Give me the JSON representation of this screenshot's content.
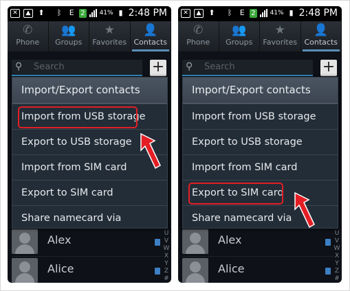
{
  "status_bar": {
    "time": "2:48 PM",
    "battery": "41%",
    "sim_badge": "2",
    "network": "E"
  },
  "tabs": [
    {
      "label": "Phone",
      "icon": "phone-icon"
    },
    {
      "label": "Groups",
      "icon": "groups-icon"
    },
    {
      "label": "Favorites",
      "icon": "star-icon"
    },
    {
      "label": "Contacts",
      "icon": "person-icon",
      "active": true
    }
  ],
  "search": {
    "placeholder": "Search"
  },
  "dialog": {
    "title": "Import/Export contacts",
    "items": [
      "Import from USB storage",
      "Export to USB storage",
      "Import from SIM card",
      "Export to SIM card",
      "Share namecard via"
    ]
  },
  "contacts": [
    "Alex",
    "Alice"
  ],
  "index_letters": [
    "U",
    "V",
    "W",
    "X",
    "Y",
    "Z",
    "#"
  ],
  "highlight": {
    "left_screen_item": "Import from USB storage",
    "right_screen_item": "Export to SIM card",
    "color": "#e31e24"
  }
}
